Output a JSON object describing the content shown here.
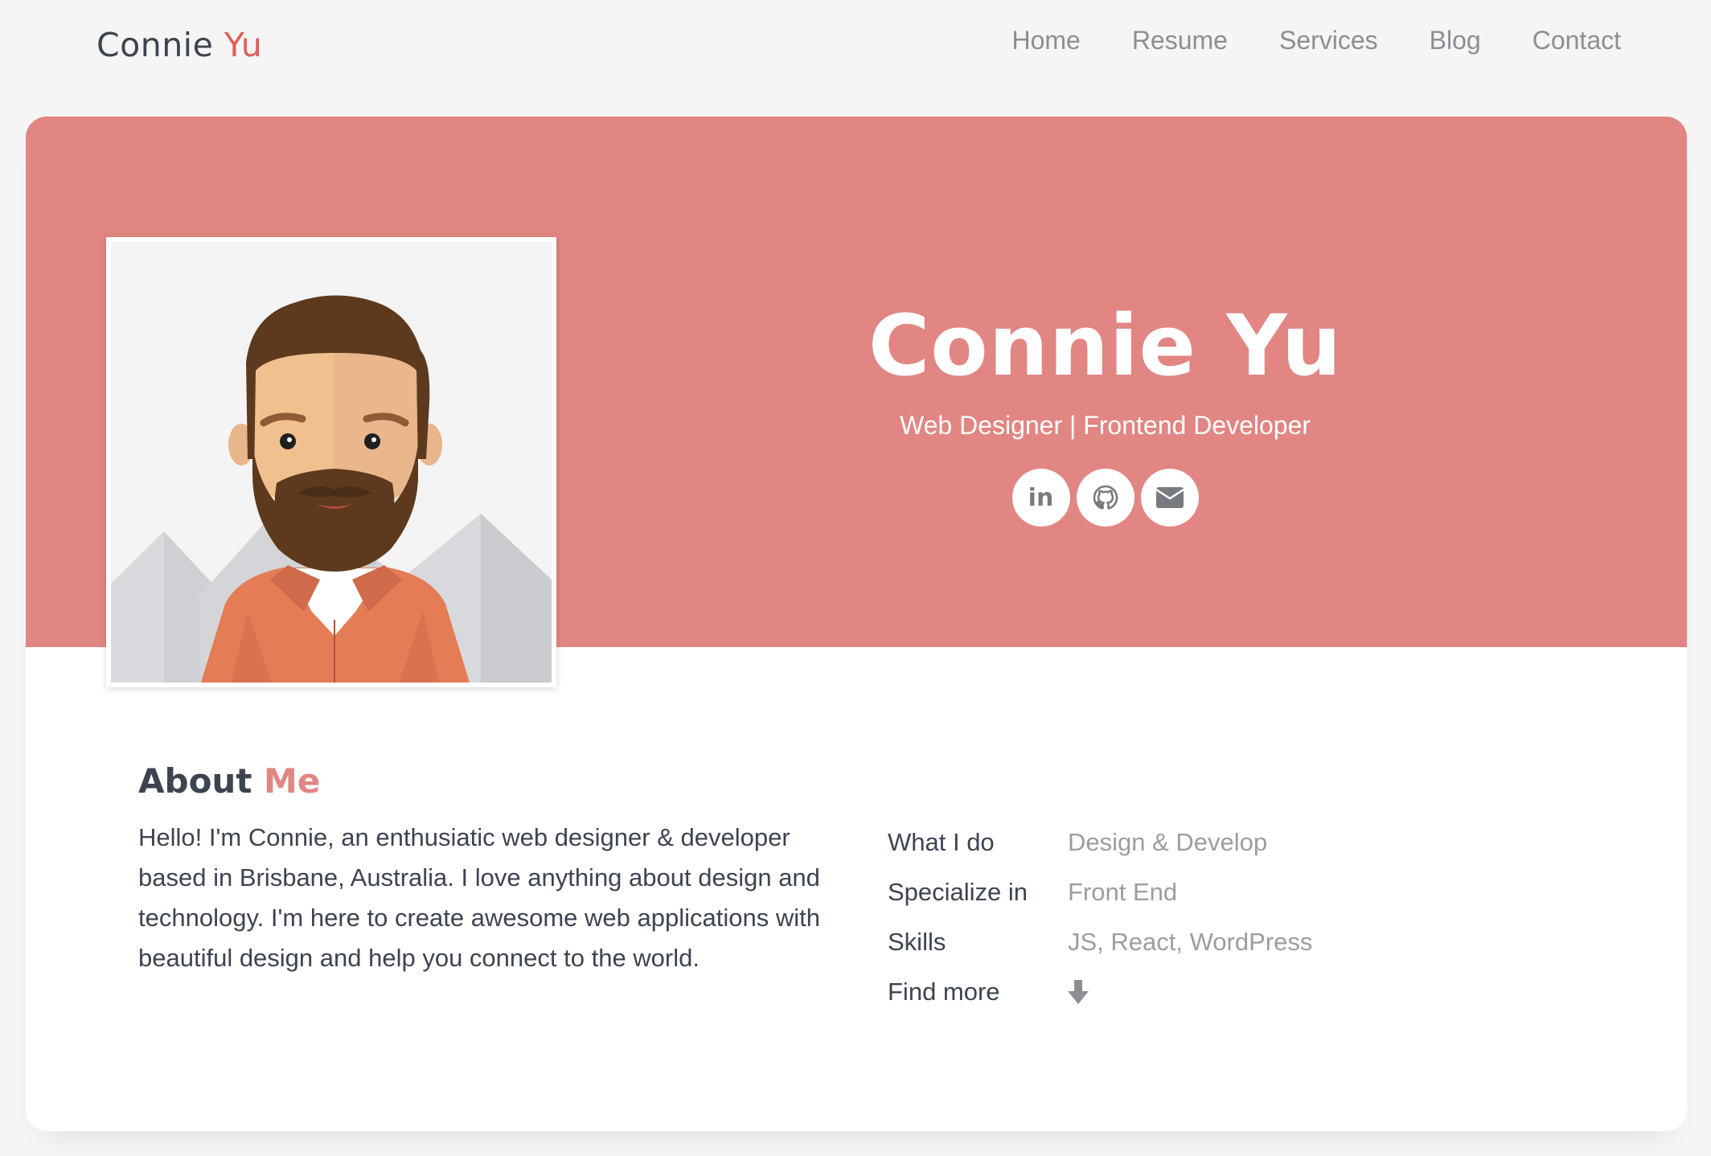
{
  "header": {
    "brand_first": "Connie",
    "brand_last": "Yu",
    "nav": [
      {
        "label": "Home"
      },
      {
        "label": "Resume"
      },
      {
        "label": "Services"
      },
      {
        "label": "Blog"
      },
      {
        "label": "Contact"
      }
    ]
  },
  "hero": {
    "name": "Connie Yu",
    "role": "Web Designer | Frontend Developer",
    "socials": [
      {
        "icon": "linkedin-icon",
        "text": "in"
      },
      {
        "icon": "github-icon"
      },
      {
        "icon": "envelope-icon"
      }
    ],
    "avatar": "avatar-illustration"
  },
  "about": {
    "title_first": "About",
    "title_accent": "Me",
    "text": "Hello! I'm Connie, an enthusiatic web designer & developer based in Brisbane, Australia. I love anything about design and technology. I'm here to create awesome web applications with beautiful design and help you connect to the world.",
    "facts": [
      {
        "label": "What I do",
        "value": "Design & Develop"
      },
      {
        "label": "Specialize in",
        "value": "Front End"
      },
      {
        "label": "Skills",
        "value": "JS, React, WordPress"
      },
      {
        "label": "Find more",
        "icon": "arrow-down-icon"
      }
    ]
  },
  "colors": {
    "accent": "#e05d5d",
    "hero_bg": "#e18683",
    "page_bg": "#f5f5f5",
    "text_dark": "#3d4451",
    "text_muted": "#9a9ea3"
  }
}
